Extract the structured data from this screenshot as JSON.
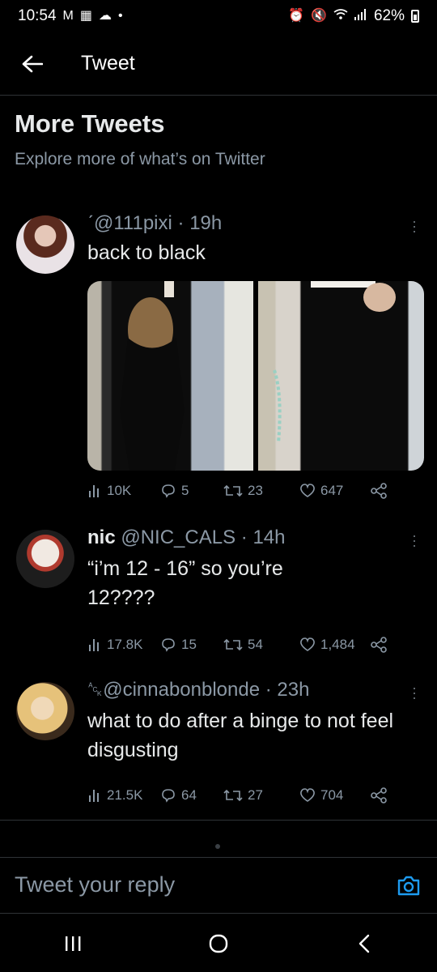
{
  "status_bar": {
    "time": "10:54",
    "battery": "62%",
    "left_icons": [
      "gmail-icon",
      "calendar-icon",
      "cloud-icon",
      "dot-icon"
    ],
    "right_icons": [
      "alarm-icon",
      "mute-icon",
      "wifi-icon",
      "signal-icon",
      "battery-icon"
    ]
  },
  "header": {
    "title": "Tweet",
    "back_icon": "arrow-left-icon"
  },
  "section": {
    "title": "More Tweets",
    "subtitle": "Explore more of what’s on Twitter"
  },
  "tweets": [
    {
      "name": "",
      "handle": "ˊ@111pixi",
      "time": "· 19h",
      "text": "back to black",
      "has_media": true,
      "views": "10K",
      "replies": "5",
      "retweets": "23",
      "likes": "647"
    },
    {
      "name": "nic",
      "handle": "@NIC_CALS",
      "time": "· 14h",
      "text": "“i’m 12 - 16” so you’re 12????",
      "has_media": false,
      "views": "17.8K",
      "replies": "15",
      "retweets": "54",
      "likes": "1,484"
    },
    {
      "name": "",
      "handle": "␆@cinnabonblonde",
      "time": "· 23h",
      "text": "what to do after a binge to not feel disgusting",
      "has_media": false,
      "views": "21.5K",
      "replies": "64",
      "retweets": "27",
      "likes": "704"
    }
  ],
  "reply_bar": {
    "placeholder": "Tweet your reply",
    "icon": "camera-icon"
  },
  "nav_bar": {
    "icons": [
      "recents-icon",
      "home-icon",
      "back-icon"
    ]
  },
  "colors": {
    "background": "#000000",
    "text": "#e7e9ea",
    "muted": "#8b98a5",
    "accent": "#1d9bf0",
    "divider": "#2f3336"
  }
}
